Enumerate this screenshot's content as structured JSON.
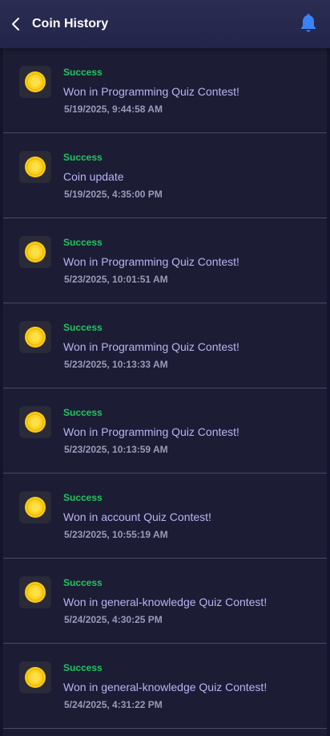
{
  "header": {
    "title": "Coin History",
    "back_icon": "chevron-left-icon",
    "bell_icon": "bell-icon"
  },
  "colors": {
    "header_bg": "#262850",
    "list_bg": "#1c1c35",
    "success": "#22c55e",
    "description": "#b7b5f0",
    "timestamp": "#9b9bb8",
    "bell": "#3b82f6",
    "coin": "#facc15"
  },
  "transactions": [
    {
      "status": "Success",
      "description": "Won in Programming Quiz Contest!",
      "time": "5/19/2025, 9:44:58 AM"
    },
    {
      "status": "Success",
      "description": "Coin update",
      "time": "5/19/2025, 4:35:00 PM"
    },
    {
      "status": "Success",
      "description": "Won in Programming Quiz Contest!",
      "time": "5/23/2025, 10:01:51 AM"
    },
    {
      "status": "Success",
      "description": "Won in Programming Quiz Contest!",
      "time": "5/23/2025, 10:13:33 AM"
    },
    {
      "status": "Success",
      "description": "Won in Programming Quiz Contest!",
      "time": "5/23/2025, 10:13:59 AM"
    },
    {
      "status": "Success",
      "description": "Won in account Quiz Contest!",
      "time": "5/23/2025, 10:55:19 AM"
    },
    {
      "status": "Success",
      "description": "Won in general-knowledge Quiz Contest!",
      "time": "5/24/2025, 4:30:25 PM"
    },
    {
      "status": "Success",
      "description": "Won in general-knowledge Quiz Contest!",
      "time": "5/24/2025, 4:31:22 PM"
    }
  ]
}
